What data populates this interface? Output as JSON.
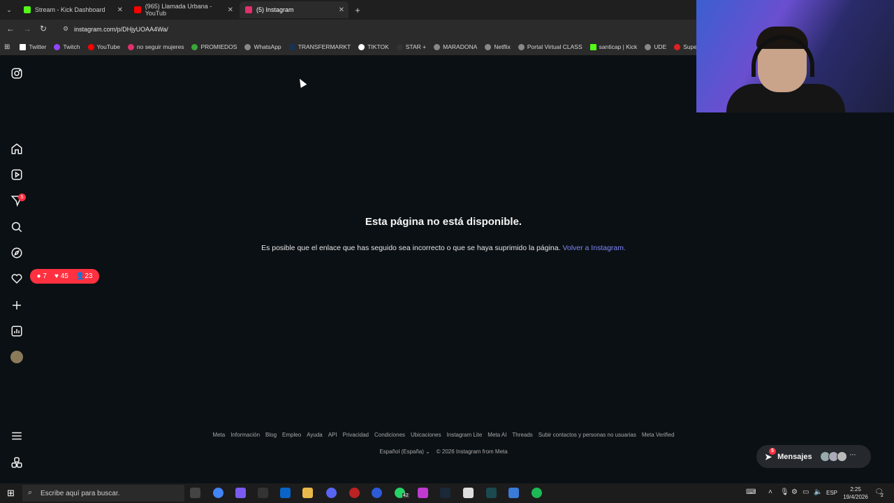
{
  "browser": {
    "tabs": [
      {
        "label": "Stream - Kick Dashboard",
        "color": "#53fc18"
      },
      {
        "label": "(965) Llamada Urbana - YouTub",
        "color": "#ff0000"
      },
      {
        "label": "(5) Instagram",
        "color": "#e1306c"
      }
    ],
    "new_tab": "+",
    "url": "instagram.com/p/DHjyUOAA4Wa/",
    "bookmarks": [
      {
        "label": "Twitter",
        "color": "#ffffff"
      },
      {
        "label": "Twitch",
        "color": "#9146ff"
      },
      {
        "label": "YouTube",
        "color": "#ff0000"
      },
      {
        "label": "no seguir mujeres",
        "color": "#e1306c"
      },
      {
        "label": "PROMIEDOS",
        "color": "#3aa63a"
      },
      {
        "label": "WhatsApp",
        "color": "#888888"
      },
      {
        "label": "TRANSFERMARKT",
        "color": "#1a3151"
      },
      {
        "label": "TIKTOK",
        "color": "#ffffff"
      },
      {
        "label": "STAR +",
        "color": "#333333"
      },
      {
        "label": "MARADONA",
        "color": "#888888"
      },
      {
        "label": "Netflix",
        "color": "#888888"
      },
      {
        "label": "Portal Virtual CLASS",
        "color": "#888888"
      },
      {
        "label": "santicap | Kick",
        "color": "#53fc18"
      },
      {
        "label": "UDE",
        "color": "#888888"
      },
      {
        "label": "Supermatch",
        "color": "#e02020"
      }
    ]
  },
  "sidebar": {
    "notification_count": "5",
    "activity": {
      "comments": "7",
      "likes": "45",
      "follows": "23"
    }
  },
  "error": {
    "title": "Esta página no está disponible.",
    "description": "Es posible que el enlace que has seguido sea incorrecto o que se haya suprimido la página.",
    "link": "Volver a Instagram."
  },
  "footer": {
    "links": [
      "Meta",
      "Información",
      "Blog",
      "Empleo",
      "Ayuda",
      "API",
      "Privacidad",
      "Condiciones",
      "Ubicaciones",
      "Instagram Lite",
      "Meta AI",
      "Threads",
      "Subir contactos y personas no usuarias",
      "Meta Verified"
    ],
    "language": "Español (España)",
    "copyright": "© 2026 Instagram from Meta"
  },
  "messages": {
    "label": "Mensajes",
    "badge": "5"
  },
  "taskbar": {
    "search_placeholder": "Escribe aquí para buscar.",
    "whatsapp_badge": "42",
    "lang": "ESP",
    "time": "2:25",
    "date": "19/4/2026",
    "notif_badge": "2"
  }
}
